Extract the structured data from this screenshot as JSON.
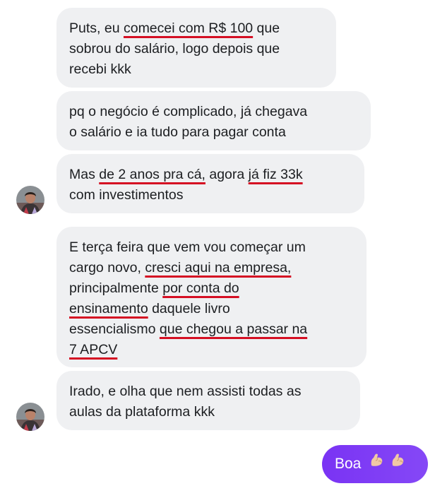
{
  "colors": {
    "received_bubble": "#eff0f2",
    "sent_bubble": "#7b3bf5",
    "highlight_underline": "#d50f23",
    "text": "#1c1e21"
  },
  "messages": [
    {
      "lines": [
        [
          {
            "t": "Puts, eu "
          },
          {
            "t": "comecei com R$ 100",
            "hl": true
          },
          {
            "t": " que"
          }
        ],
        [
          {
            "t": "sobrou do salário, logo depois que"
          }
        ],
        [
          {
            "t": "recebi kkk"
          }
        ]
      ]
    },
    {
      "lines": [
        [
          {
            "t": "pq o negócio é complicado, já chegava"
          }
        ],
        [
          {
            "t": "o salário e ia tudo para pagar conta"
          }
        ]
      ]
    },
    {
      "lines": [
        [
          {
            "t": "Mas "
          },
          {
            "t": "de 2 anos pra cá,",
            "hl": true
          },
          {
            "t": " agora "
          },
          {
            "t": "já fiz 33k",
            "hl": true
          }
        ],
        [
          {
            "t": "com investimentos"
          }
        ]
      ]
    },
    {
      "lines": [
        [
          {
            "t": "E terça feira que vem vou começar um"
          }
        ],
        [
          {
            "t": "cargo novo, "
          },
          {
            "t": "cresci aqui na empresa,",
            "hl": true
          }
        ],
        [
          {
            "t": "principalmente "
          },
          {
            "t": "por conta do",
            "hl": true
          }
        ],
        [
          {
            "t": "ensinamento",
            "hl": true
          },
          {
            "t": " daquele livro"
          }
        ],
        [
          {
            "t": "essencialismo "
          },
          {
            "t": "que chegou a passar na",
            "hl": true
          }
        ],
        [
          {
            "t": "7 APCV",
            "hl": true
          }
        ]
      ]
    },
    {
      "lines": [
        [
          {
            "t": "Irado, e olha que nem assisti todas as"
          }
        ],
        [
          {
            "t": "aulas da plataforma kkk"
          }
        ]
      ]
    }
  ],
  "avatars": [
    {
      "name": "contact-avatar"
    },
    {
      "name": "contact-avatar"
    }
  ],
  "reply": {
    "text": "Boa",
    "emoji": [
      "flexed-biceps-icon",
      "flexed-biceps-icon"
    ]
  }
}
